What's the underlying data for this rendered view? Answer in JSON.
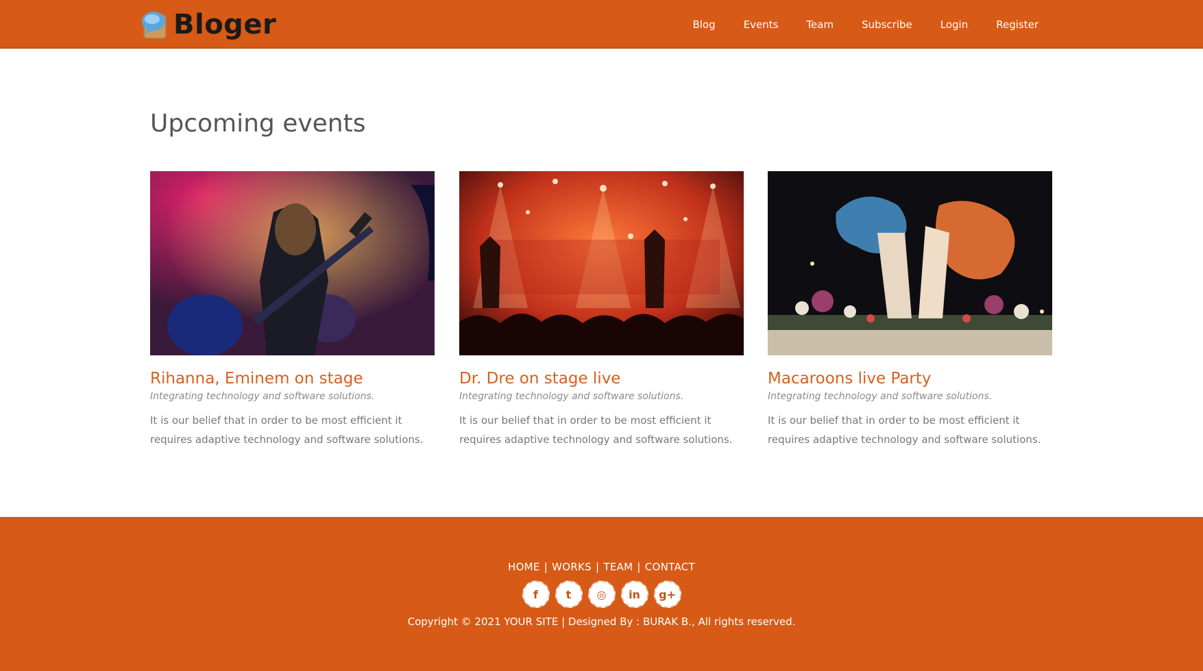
{
  "header": {
    "logo_text": "Bloger",
    "nav": [
      "Blog",
      "Events",
      "Team",
      "Subscribe",
      "Login",
      "Register"
    ]
  },
  "main": {
    "section_title": "Upcoming events",
    "events": [
      {
        "title": "Rihanna, Eminem on stage",
        "subtitle": "Integrating technology and software solutions.",
        "description": "It is our belief that in order to be most efficient it requires adaptive technology and software solutions."
      },
      {
        "title": "Dr. Dre on stage live",
        "subtitle": "Integrating technology and software solutions.",
        "description": "It is our belief that in order to be most efficient it requires adaptive technology and software solutions."
      },
      {
        "title": "Macaroons live Party",
        "subtitle": "Integrating technology and software solutions.",
        "description": "It is our belief that in order to be most efficient it requires adaptive technology and software solutions."
      }
    ]
  },
  "footer": {
    "links": [
      "HOME",
      "WORKS",
      "TEAM",
      "CONTACT"
    ],
    "separator": "|",
    "social_icons": [
      {
        "name": "facebook-icon",
        "glyph": "f"
      },
      {
        "name": "twitter-icon",
        "glyph": "t"
      },
      {
        "name": "dribbble-icon",
        "glyph": "◎"
      },
      {
        "name": "linkedin-icon",
        "glyph": "in"
      },
      {
        "name": "google-plus-icon",
        "glyph": "g+"
      }
    ],
    "copyright": "Copyright © 2021 YOUR SITE | Designed By : BURAK B., All rights reserved."
  },
  "colors": {
    "brand": "#d75a16",
    "accent_text": "#d6601f"
  }
}
